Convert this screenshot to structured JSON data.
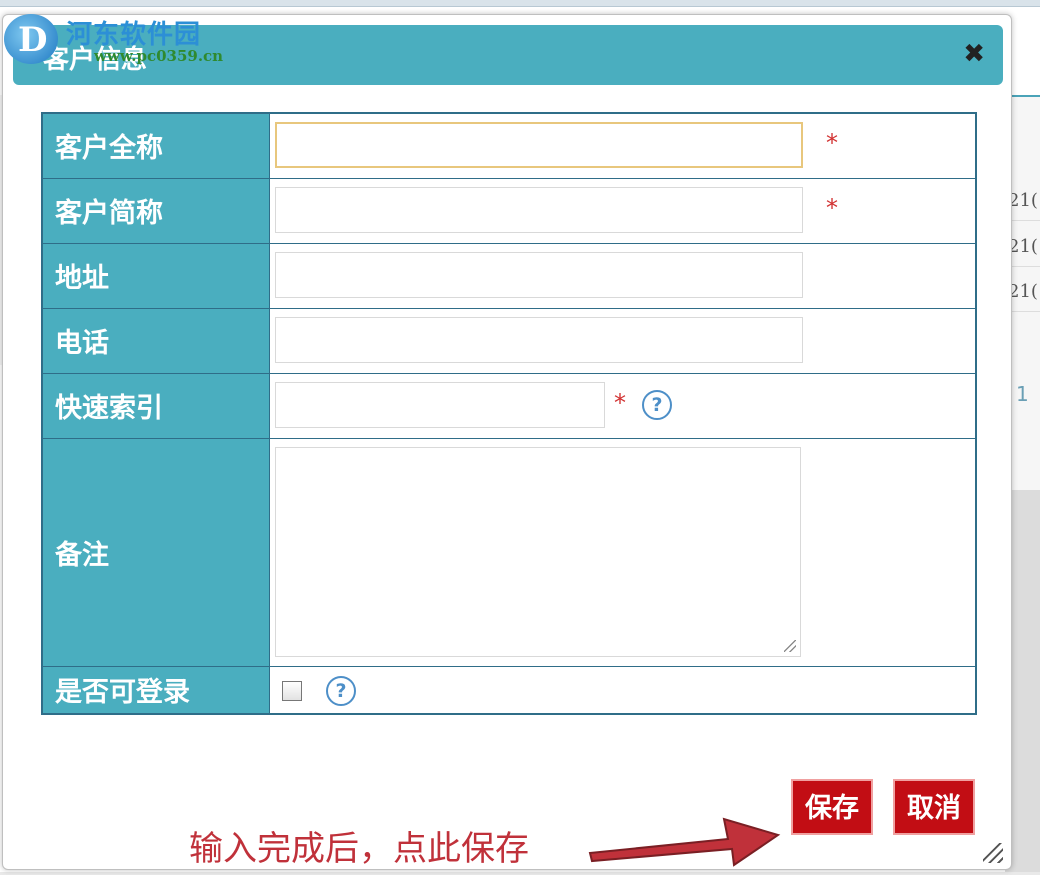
{
  "watermark": {
    "title": "河东软件园",
    "url": "www.pc0359.cn"
  },
  "background": {
    "cells": [
      "21(",
      "21(",
      "21("
    ],
    "page_number": "1"
  },
  "dialog": {
    "title": "客户信息",
    "close_label": "✖",
    "fields": [
      {
        "label": "客户全称",
        "value": "",
        "required": "*"
      },
      {
        "label": "客户简称",
        "value": "",
        "required": "*"
      },
      {
        "label": "地址",
        "value": ""
      },
      {
        "label": "电话",
        "value": ""
      },
      {
        "label": "快速索引",
        "value": "",
        "required": "*",
        "help": "?"
      },
      {
        "label": "备注",
        "value": ""
      },
      {
        "label": "是否可登录",
        "checked": false,
        "help": "?"
      }
    ],
    "buttons": {
      "save": "保存",
      "cancel": "取消"
    },
    "annotation": "输入完成后，点此保存"
  },
  "colors": {
    "header": "#4aaebf",
    "label_bg": "#4aaebf",
    "border": "#2f6d88",
    "button": "#c20d14",
    "required": "#d23232",
    "annotation": "#c0313a"
  }
}
